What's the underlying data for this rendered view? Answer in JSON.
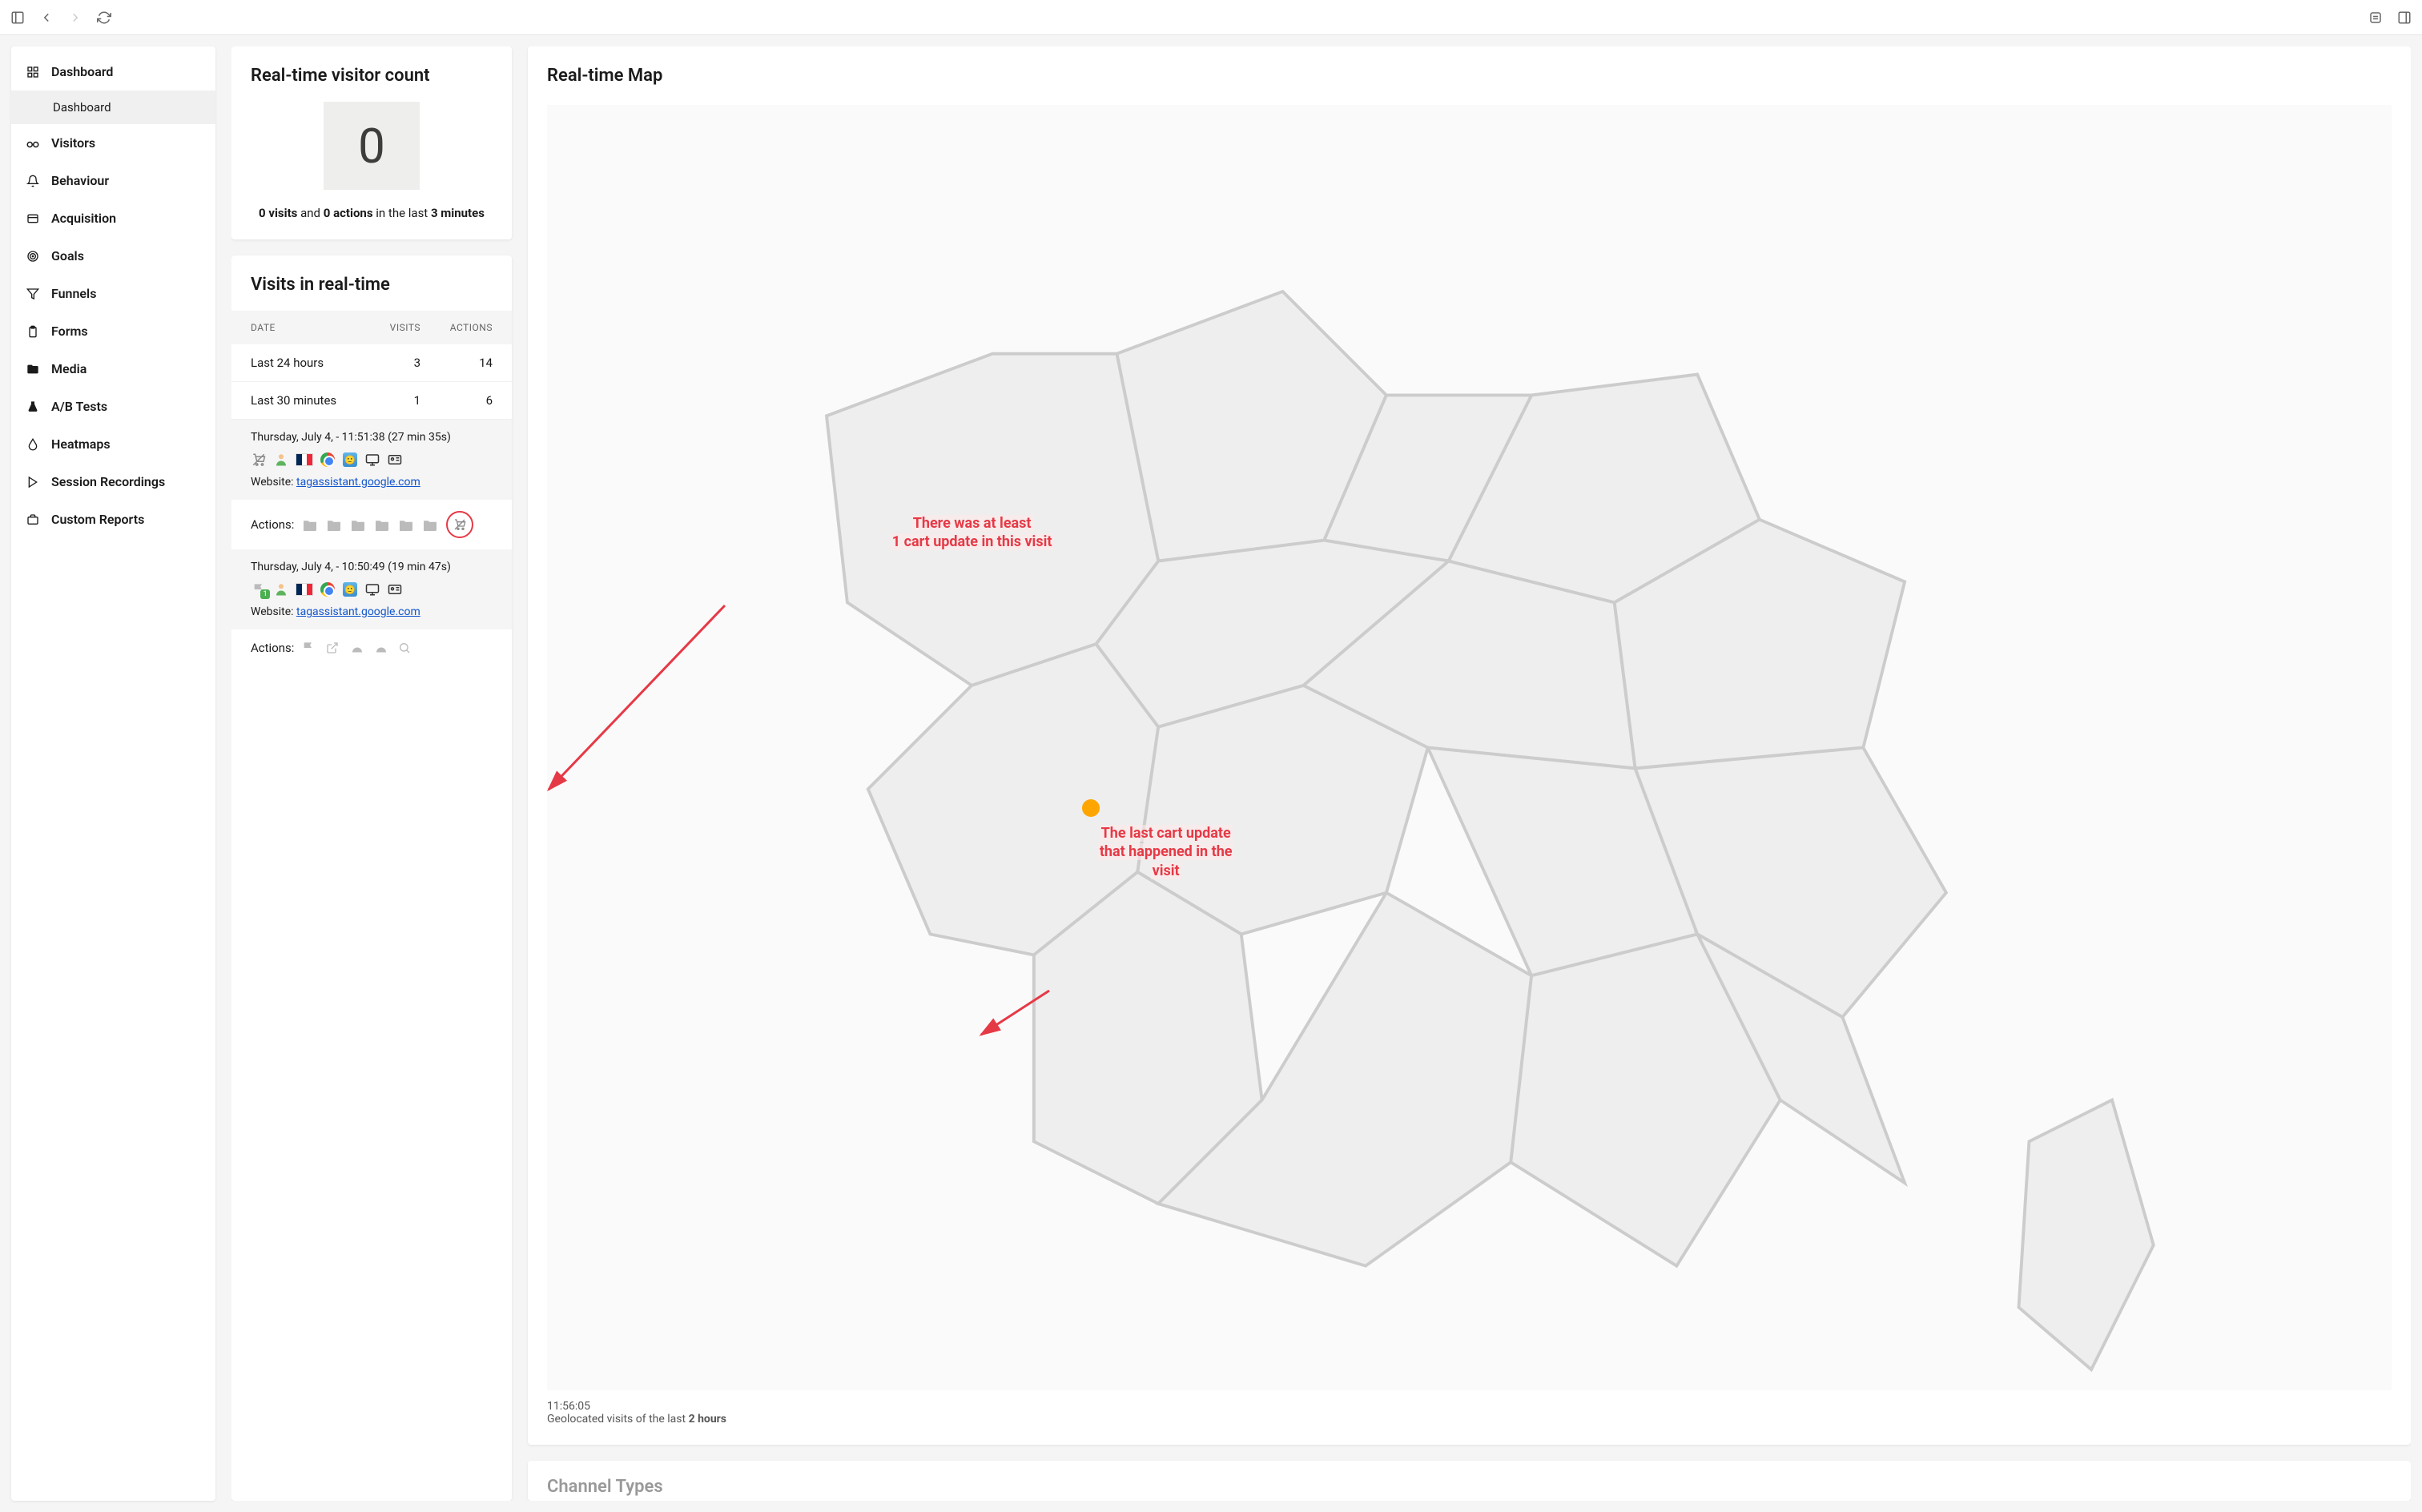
{
  "sidebar": {
    "items": [
      {
        "label": "Dashboard",
        "icon": "grid"
      },
      {
        "label": "Visitors",
        "icon": "glasses"
      },
      {
        "label": "Behaviour",
        "icon": "bell"
      },
      {
        "label": "Acquisition",
        "icon": "inbox"
      },
      {
        "label": "Goals",
        "icon": "target"
      },
      {
        "label": "Funnels",
        "icon": "funnel"
      },
      {
        "label": "Forms",
        "icon": "clipboard"
      },
      {
        "label": "Media",
        "icon": "folder"
      },
      {
        "label": "A/B Tests",
        "icon": "flask"
      },
      {
        "label": "Heatmaps",
        "icon": "drop"
      },
      {
        "label": "Session Recordings",
        "icon": "play"
      },
      {
        "label": "Custom Reports",
        "icon": "suitcase"
      }
    ],
    "subitem": "Dashboard"
  },
  "visitor_count": {
    "title": "Real-time visitor count",
    "count": "0",
    "visits": "0 visits",
    "and": " and ",
    "actions": "0 actions",
    "suffix": " in the last ",
    "minutes": "3 minutes"
  },
  "visits_realtime": {
    "title": "Visits in real-time",
    "headers": {
      "date": "DATE",
      "visits": "VISITS",
      "actions": "ACTIONS"
    },
    "rows": [
      {
        "label": "Last 24 hours",
        "visits": "3",
        "actions": "14"
      },
      {
        "label": "Last 30 minutes",
        "visits": "1",
        "actions": "6"
      }
    ],
    "entries": [
      {
        "timestamp": "Thursday, July 4, - 11:51:38 (27 min 35s)",
        "website_label": "Website: ",
        "website": "tagassistant.google.com",
        "actions_label": "Actions:",
        "folder_count": 6,
        "cart_circled": true
      },
      {
        "timestamp": "Thursday, July 4, - 10:50:49 (19 min 47s)",
        "website_label": "Website: ",
        "website": "tagassistant.google.com",
        "actions_label": "Actions:"
      }
    ]
  },
  "map": {
    "title": "Real-time Map",
    "timestamp": "11:56:05",
    "footer_prefix": "Geolocated visits of the last ",
    "footer_duration": "2 hours"
  },
  "channel": {
    "title": "Channel Types"
  },
  "annotations": {
    "a1_line1": "There was at least",
    "a1_line2": "1 cart update in this visit",
    "a2_line1": "The last cart update",
    "a2_line2": "that happened in the",
    "a2_line3": "visit"
  }
}
